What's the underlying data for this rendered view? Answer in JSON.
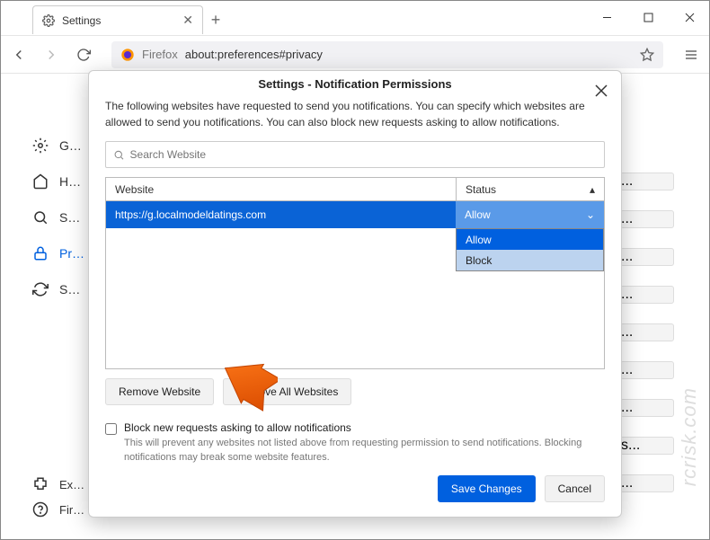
{
  "window": {
    "tab_title": "Settings",
    "new_tab_glyph": "+",
    "min_title": "Minimize",
    "max_title": "Restore",
    "close_title": "Close"
  },
  "toolbar": {
    "url_label": "Firefox",
    "url_text": "about:preferences#privacy"
  },
  "sidebar": {
    "items": [
      {
        "label": "General"
      },
      {
        "label": "Home"
      },
      {
        "label": "Search"
      },
      {
        "label": "Privacy & Security"
      },
      {
        "label": "Sync"
      }
    ],
    "bottom": [
      {
        "label": "Extensions & Themes"
      },
      {
        "label": "Firefox Support"
      }
    ]
  },
  "dialog": {
    "title": "Settings - Notification Permissions",
    "description": "The following websites have requested to send you notifications. You can specify which websites are allowed to send you notifications. You can also block new requests asking to allow notifications.",
    "search_placeholder": "Search Website",
    "columns": {
      "website": "Website",
      "status": "Status"
    },
    "row": {
      "url": "https://g.localmodeldatings.com",
      "status": "Allow"
    },
    "dropdown": {
      "opt1": "Allow",
      "opt2": "Block"
    },
    "remove_label": "Remove Website",
    "remove_all_label": "Remove All Websites",
    "block_new_label": "Block new requests asking to allow notifications",
    "block_new_desc": "This will prevent any websites not listed above from requesting permission to send notifications. Blocking notifications may break some website features.",
    "save_label": "Save Changes",
    "cancel_label": "Cancel"
  },
  "watermark": "rcrisk.com",
  "ellipsis": "..."
}
